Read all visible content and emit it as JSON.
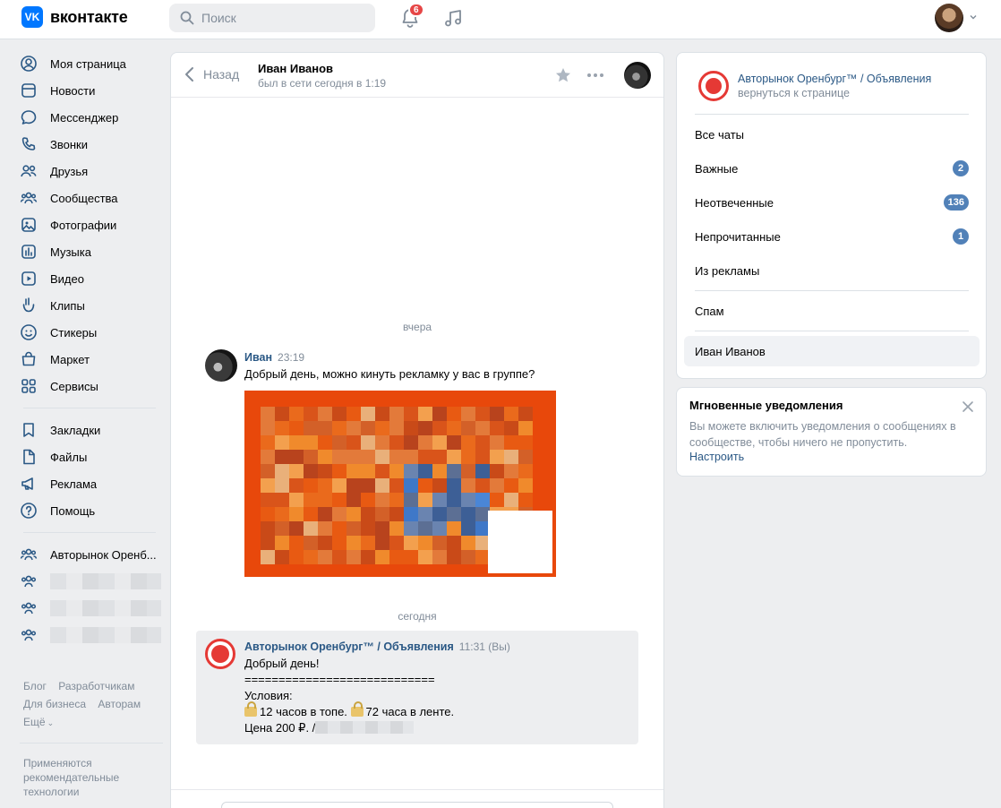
{
  "header": {
    "logo_text": "вконтакте",
    "search_placeholder": "Поиск",
    "notifications_count": "6"
  },
  "sidebar": {
    "items": [
      {
        "label": "Моя страница",
        "icon": "user-icon"
      },
      {
        "label": "Новости",
        "icon": "news-icon"
      },
      {
        "label": "Мессенджер",
        "icon": "message-icon"
      },
      {
        "label": "Звонки",
        "icon": "phone-icon"
      },
      {
        "label": "Друзья",
        "icon": "friends-icon"
      },
      {
        "label": "Сообщества",
        "icon": "communities-icon"
      },
      {
        "label": "Фотографии",
        "icon": "photo-icon"
      },
      {
        "label": "Музыка",
        "icon": "music-icon"
      },
      {
        "label": "Видео",
        "icon": "video-icon"
      },
      {
        "label": "Клипы",
        "icon": "clips-icon"
      },
      {
        "label": "Стикеры",
        "icon": "sticker-icon"
      },
      {
        "label": "Маркет",
        "icon": "market-icon"
      },
      {
        "label": "Сервисы",
        "icon": "services-icon"
      }
    ],
    "items2": [
      {
        "label": "Закладки",
        "icon": "bookmark-icon"
      },
      {
        "label": "Файлы",
        "icon": "file-icon"
      },
      {
        "label": "Реклама",
        "icon": "megaphone-icon"
      },
      {
        "label": "Помощь",
        "icon": "help-icon"
      }
    ],
    "groups": [
      {
        "label": "Авторынок Оренб..."
      }
    ],
    "footer": {
      "blog": "Блог",
      "developers": "Разработчикам",
      "business": "Для бизнеса",
      "authors": "Авторам",
      "more": "Ещё"
    },
    "rec_text": "Применяются рекомендательные технологии"
  },
  "chat": {
    "back_label": "Назад",
    "peer_name": "Иван Иванов",
    "peer_status": "был в сети сегодня в 1:19",
    "day_yesterday": "вчера",
    "day_today": "сегодня",
    "msg1": {
      "author": "Иван",
      "time": "23:19",
      "text": "Добрый день, можно кинуть рекламку у вас в группе?"
    },
    "msg2": {
      "author": "Авторынок Оренбург™ / Объявления",
      "time": "11:31 (Вы)",
      "line1": "Добрый день!",
      "line2": "============================",
      "line3": "Условия:",
      "line4a": "12 часов в топе.",
      "line4b": "72 часа в ленте.",
      "line5": "Цена 200 ₽. /"
    }
  },
  "right_panel": {
    "group_name": "Авторынок Оренбург™ / Объявления",
    "group_back": "вернуться к странице",
    "folders": [
      {
        "label": "Все чаты",
        "badge": ""
      },
      {
        "label": "Важные",
        "badge": "2"
      },
      {
        "label": "Неотвеченные",
        "badge": "136"
      },
      {
        "label": "Непрочитанные",
        "badge": "1"
      },
      {
        "label": "Из рекламы",
        "badge": ""
      }
    ],
    "spam_label": "Спам",
    "active_chat": "Иван Иванов"
  },
  "notify": {
    "title": "Мгновенные уведомления",
    "text": "Вы можете включить уведомления о сообщениях в сообществе, чтобы ничего не пропустить.",
    "link": "Настроить"
  },
  "colors": {
    "accent": "#2a5885",
    "brand": "#0077ff",
    "badge": "#5181b8",
    "notification": "#e64646",
    "ad_orange": "#e8480b"
  }
}
